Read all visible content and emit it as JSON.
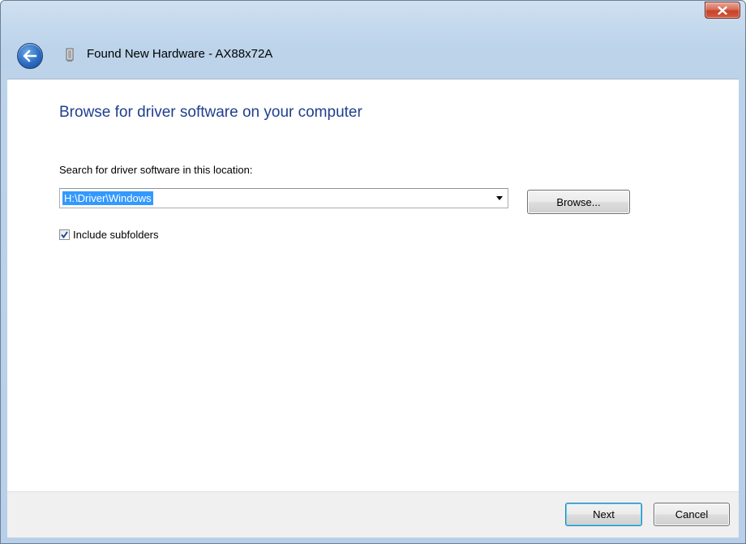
{
  "window": {
    "title": "Found New Hardware - AX88x72A",
    "close_icon": "close-icon",
    "back_icon": "back-arrow-icon",
    "hardware_icon": "hardware-device-icon"
  },
  "main": {
    "heading": "Browse for driver software on your computer",
    "search_label": "Search for driver software in this location:",
    "location_value": "H:\\Driver\\Windows",
    "browse_label": "Browse...",
    "include_subfolders_label": "Include subfolders",
    "include_subfolders_checked": true
  },
  "footer": {
    "next_label": "Next",
    "cancel_label": "Cancel"
  },
  "colors": {
    "heading": "#1e3f8f",
    "selection": "#3399ff",
    "frame": "#bcd3ea",
    "close_button": "#c7432a"
  }
}
